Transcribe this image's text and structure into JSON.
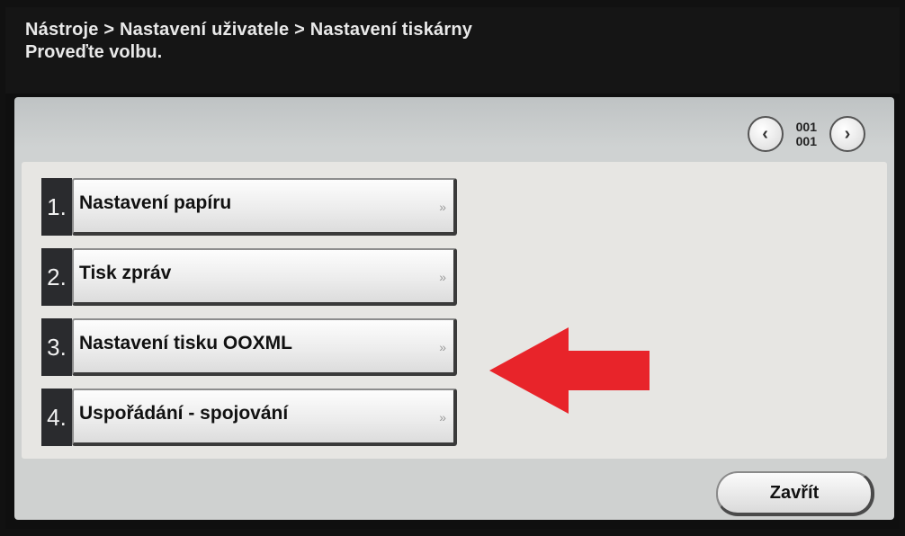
{
  "header": {
    "breadcrumb": "Nástroje > Nastavení uživatele > Nastavení tiskárny",
    "prompt": "Proveďte volbu."
  },
  "pager": {
    "current": "001",
    "total": "001",
    "prev_icon": "chevron-left-icon",
    "next_icon": "chevron-right-icon",
    "prev_glyph": "‹",
    "next_glyph": "›"
  },
  "menu": {
    "items": [
      {
        "number": "1.",
        "label": "Nastavení papíru",
        "arrow": "»"
      },
      {
        "number": "2.",
        "label": "Tisk zpráv",
        "arrow": "»"
      },
      {
        "number": "3.",
        "label": "Nastavení tisku OOXML",
        "arrow": "»"
      },
      {
        "number": "4.",
        "label": "Uspořádání - spojování",
        "arrow": "»"
      }
    ]
  },
  "annotation": {
    "icon": "red-arrow-pointer-icon",
    "color": "#e8242a"
  },
  "footer": {
    "close_label": "Zavřít"
  },
  "colors": {
    "header_bg": "#151515",
    "panel_bg": "#cfd1d0",
    "list_bg": "#e7e6e3",
    "number_bg": "#2a2b2e"
  }
}
